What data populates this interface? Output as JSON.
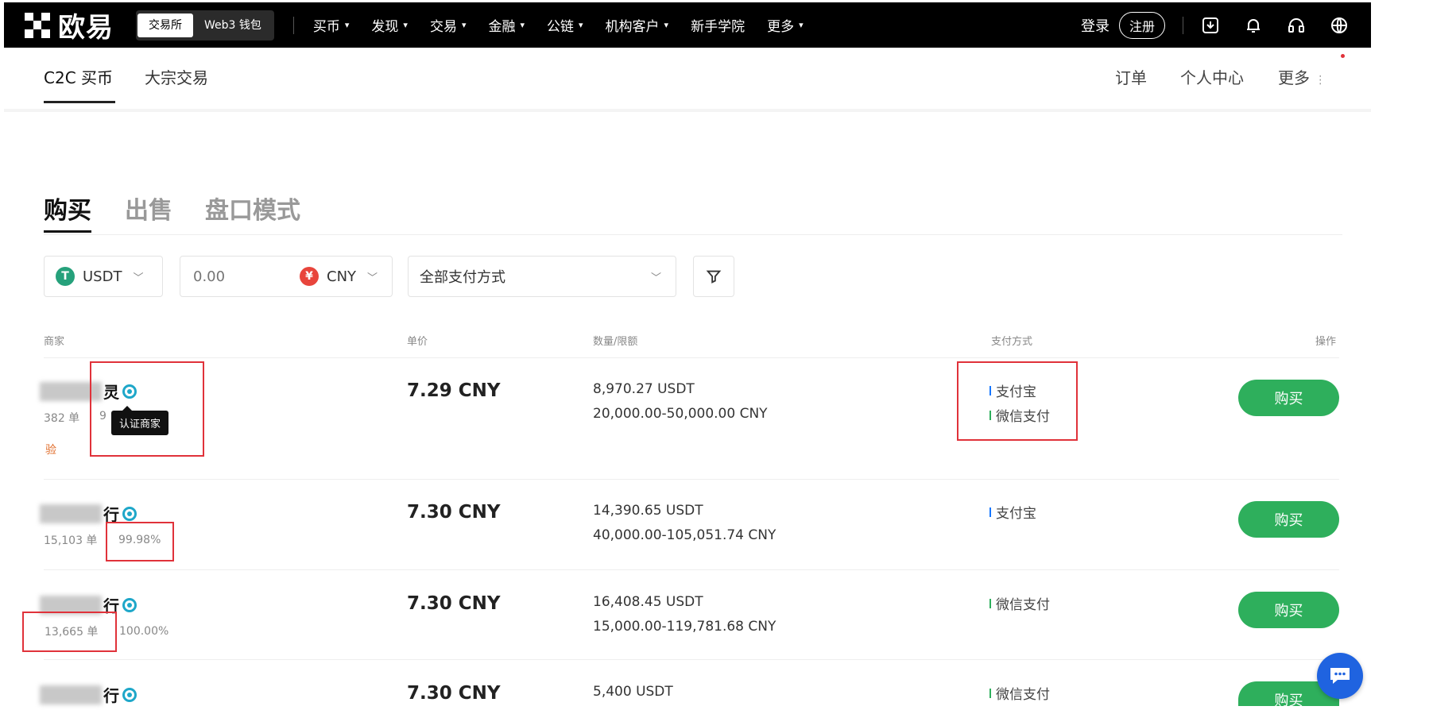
{
  "nav": {
    "logo": "欧易",
    "segment_exchange": "交易所",
    "segment_wallet": "Web3 钱包",
    "items": [
      "买币",
      "发现",
      "交易",
      "金融",
      "公链",
      "机构客户"
    ],
    "academy": "新手学院",
    "more": "更多",
    "login": "登录",
    "register": "注册"
  },
  "subnav": {
    "tab_c2c": "C2C 买币",
    "tab_bulk": "大宗交易",
    "orders": "订单",
    "profile": "个人中心",
    "more": "更多"
  },
  "tabs": {
    "buy": "购买",
    "sell": "出售",
    "orderbook": "盘口模式"
  },
  "filters": {
    "coin": "USDT",
    "amount_placeholder": "0.00",
    "fiat": "CNY",
    "payment": "全部支付方式"
  },
  "table": {
    "headers": {
      "merchant": "商家",
      "price": "单价",
      "qty": "数量/限额",
      "payment": "支付方式",
      "action": "操作"
    },
    "rows": [
      {
        "name_suffix": "灵",
        "orders": "382 单",
        "rate": "9",
        "price": "7.29 CNY",
        "qty": "8,970.27 USDT",
        "limit": "20,000.00-50,000.00 CNY",
        "pay1": "支付宝",
        "pay2": "微信支付",
        "action": "购买",
        "tag": "验"
      },
      {
        "name_suffix": "行",
        "orders": "15,103 单",
        "rate": "99.98%",
        "price": "7.30 CNY",
        "qty": "14,390.65 USDT",
        "limit": "40,000.00-105,051.74 CNY",
        "pay1": "支付宝",
        "action": "购买"
      },
      {
        "name_suffix": "行",
        "orders": "13,665 单",
        "rate": "100.00%",
        "price": "7.30 CNY",
        "qty": "16,408.45 USDT",
        "limit": "15,000.00-119,781.68 CNY",
        "pay1": "微信支付",
        "action": "购买"
      },
      {
        "name_suffix": "行",
        "price": "7.30 CNY",
        "qty": "5,400 USDT",
        "pay1": "微信支付",
        "action": "购买"
      }
    ]
  },
  "tooltip": "认证商家",
  "colors": {
    "buy_green": "#2eaf5c",
    "alipay": "#1677ff",
    "wechat": "#2eaf5c",
    "highlight_red": "#e0323a"
  }
}
